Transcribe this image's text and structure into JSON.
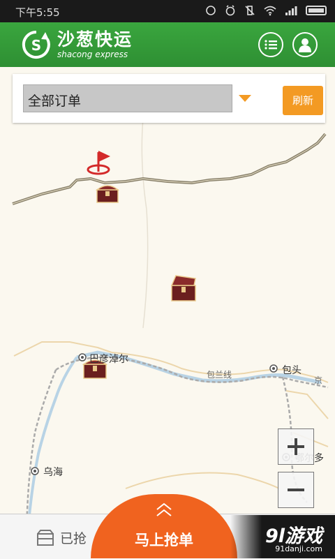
{
  "status_bar": {
    "time": "下午5:55"
  },
  "app_bar": {
    "brand_cn": "沙葱快运",
    "brand_en": "shacong express",
    "list_icon": "list-icon",
    "profile_icon": "user-icon"
  },
  "filter": {
    "selected": "全部订单",
    "refresh_label": "刷新"
  },
  "map": {
    "labels": {
      "bayannur": "巴彦淖尔",
      "baotou": "包头",
      "jing": "京",
      "baolan": "包兰线",
      "wuhai": "乌海",
      "erduo": "鄂尔多"
    },
    "zoom_in": "+",
    "zoom_out": "−"
  },
  "bottom": {
    "grabbed_label": "已抢",
    "grab_label": "马上抢单"
  },
  "watermark": {
    "brand": "9l游戏",
    "url": "91danji.com"
  },
  "colors": {
    "primary_green": "#2e9a35",
    "accent_orange": "#f39a23",
    "grab_orange": "#f0631f"
  }
}
